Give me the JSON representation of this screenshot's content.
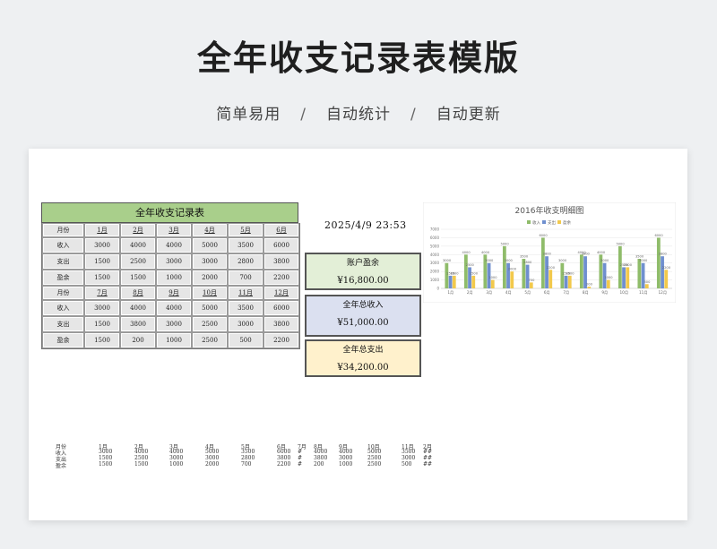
{
  "hero": {
    "title": "全年收支记录表模版",
    "tags": [
      "简单易用",
      "自动统计",
      "自动更新"
    ],
    "separator": "/"
  },
  "table": {
    "title": "全年收支记录表",
    "blocks": [
      {
        "header": [
          "月份",
          "1月",
          "2月",
          "3月",
          "4月",
          "5月",
          "6月"
        ],
        "rows": [
          [
            "收入",
            "3000",
            "4000",
            "4000",
            "5000",
            "3500",
            "6000"
          ],
          [
            "支出",
            "1500",
            "2500",
            "3000",
            "3000",
            "2800",
            "3800"
          ],
          [
            "盈余",
            "1500",
            "1500",
            "1000",
            "2000",
            "700",
            "2200"
          ]
        ]
      },
      {
        "header": [
          "月份",
          "7月",
          "8月",
          "9月",
          "10月",
          "11月",
          "12月"
        ],
        "rows": [
          [
            "收入",
            "3000",
            "4000",
            "4000",
            "5000",
            "3500",
            "6000"
          ],
          [
            "支出",
            "1500",
            "3800",
            "3000",
            "2500",
            "3000",
            "3800"
          ],
          [
            "盈余",
            "1500",
            "200",
            "1000",
            "2500",
            "500",
            "2200"
          ]
        ]
      }
    ]
  },
  "datetime": "2025/4/9  23:53",
  "summary": {
    "balance": {
      "label": "账户盈余",
      "value": "¥16,800.00"
    },
    "income": {
      "label": "全年总收入",
      "value": "¥51,000.00"
    },
    "expense": {
      "label": "全年总支出",
      "value": "¥34,200.00"
    }
  },
  "chart_data": {
    "type": "bar",
    "title": "2016年收支明细图",
    "categories": [
      "1月",
      "2月",
      "3月",
      "4月",
      "5月",
      "6月",
      "7月",
      "8月",
      "9月",
      "10月",
      "11月",
      "12月"
    ],
    "series": [
      {
        "name": "收入",
        "color": "#8fbc6a",
        "values": [
          3000,
          4000,
          4000,
          5000,
          3500,
          6000,
          3000,
          4000,
          4000,
          5000,
          3500,
          6000
        ]
      },
      {
        "name": "支出",
        "color": "#6f8fcf",
        "values": [
          1500,
          2500,
          3000,
          3000,
          2800,
          3800,
          1500,
          3800,
          3000,
          2500,
          3000,
          3800
        ]
      },
      {
        "name": "盈余",
        "color": "#f2c94c",
        "values": [
          1500,
          1500,
          1000,
          2000,
          700,
          2200,
          1500,
          200,
          1000,
          2500,
          500,
          2200
        ]
      }
    ],
    "yticks": [
      "0",
      "1000",
      "2000",
      "3000",
      "4000",
      "5000",
      "6000",
      "7000"
    ],
    "ylim": [
      0,
      7000
    ],
    "legend": "top",
    "grid": true
  },
  "mini": {
    "rows": [
      [
        "月份",
        "1月",
        "2月",
        "3月",
        "4月",
        "5月",
        "6月",
        "7月",
        "8月",
        "9月",
        "10月",
        "11月",
        "2月"
      ],
      [
        "收入",
        "3000",
        "4000",
        "4000",
        "5000",
        "3500",
        "6000",
        "#",
        "4000",
        "4000",
        "5000",
        "3500",
        "##"
      ],
      [
        "支出",
        "1500",
        "2500",
        "3000",
        "3000",
        "2800",
        "3800",
        "#",
        "3800",
        "3000",
        "2500",
        "3000",
        "##"
      ],
      [
        "盈余",
        "1500",
        "1500",
        "1000",
        "2000",
        "700",
        "2200",
        "#",
        "200",
        "1000",
        "2500",
        "500",
        "##"
      ]
    ]
  }
}
